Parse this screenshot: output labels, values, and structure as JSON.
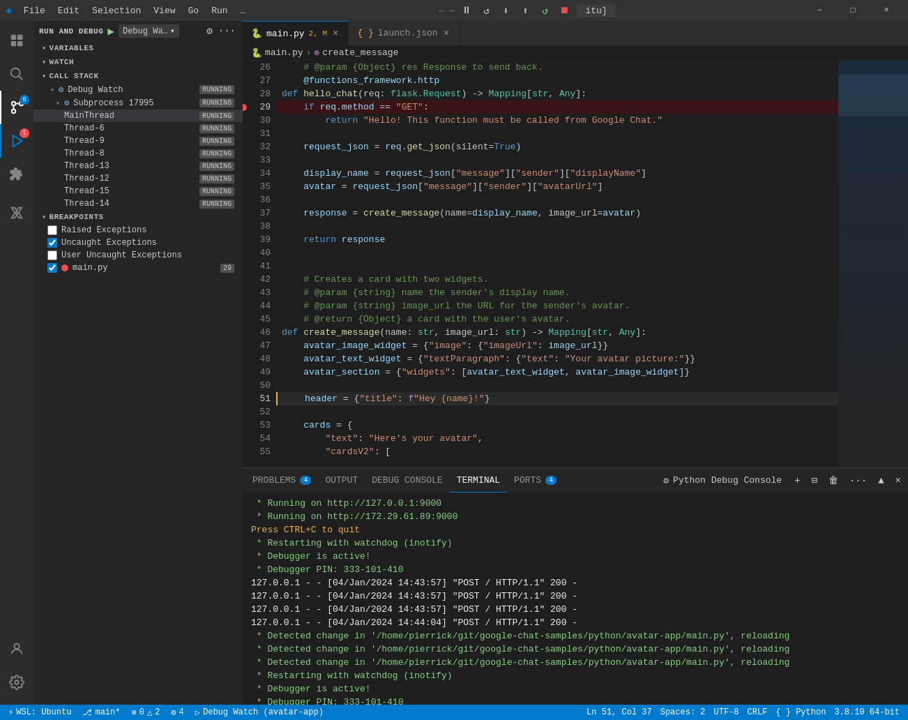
{
  "titlebar": {
    "logo": "◈",
    "menus": [
      "File",
      "Edit",
      "Selection",
      "View",
      "Go",
      "Run",
      "…"
    ],
    "debug_controls": [
      "⏪",
      "⏸",
      "↺",
      "⬇",
      "⬆",
      "⬅",
      "➡",
      "⏹"
    ],
    "nav_back": "←",
    "nav_forward": "→",
    "address": "itu]",
    "window_controls": [
      "−",
      "□",
      "×"
    ]
  },
  "activity": {
    "items": [
      "⎘",
      "🔍",
      "⎇",
      "▷",
      "☵",
      "⚗"
    ]
  },
  "sidebar": {
    "run_debug_title": "RUN AND DEBUG",
    "debug_config": "Debug Wa…",
    "sections": {
      "variables": "VARIABLES",
      "watch": "WATCH",
      "call_stack": "CALL STACK",
      "breakpoints": "BREAKPOINTS"
    },
    "call_stack_items": [
      {
        "name": "Debug Watch",
        "type": "thread",
        "badge": "RUNNING",
        "expanded": true
      },
      {
        "name": "Subprocess 17995",
        "type": "subprocess",
        "badge": "RUNNING",
        "expanded": true
      },
      {
        "name": "MainThread",
        "type": "thread",
        "badge": "RUNNING"
      },
      {
        "name": "Thread-6",
        "type": "thread",
        "badge": "RUNNING"
      },
      {
        "name": "Thread-9",
        "type": "thread",
        "badge": "RUNNING"
      },
      {
        "name": "Thread-8",
        "type": "thread",
        "badge": "RUNNING"
      },
      {
        "name": "Thread-13",
        "type": "thread",
        "badge": "RUNNING"
      },
      {
        "name": "Thread-12",
        "type": "thread",
        "badge": "RUNNING"
      },
      {
        "name": "Thread-15",
        "type": "thread",
        "badge": "RUNNING"
      },
      {
        "name": "Thread-14",
        "type": "thread",
        "badge": "RUNNING"
      }
    ],
    "breakpoints": [
      {
        "label": "Raised Exceptions",
        "checked": false,
        "has_dot": false
      },
      {
        "label": "Uncaught Exceptions",
        "checked": true,
        "has_dot": false
      },
      {
        "label": "User Uncaught Exceptions",
        "checked": false,
        "has_dot": false
      },
      {
        "label": "main.py",
        "checked": true,
        "has_dot": true,
        "count": "29"
      }
    ]
  },
  "tabs": [
    {
      "label": "main.py",
      "icon": "🐍",
      "modified": true,
      "count": "2, M",
      "active": true
    },
    {
      "label": "launch.json",
      "icon": "{}",
      "modified": false,
      "active": false
    }
  ],
  "breadcrumb": {
    "file": "main.py",
    "func": "create_message"
  },
  "code": {
    "lines": [
      {
        "num": 26,
        "content": "    # @param {Object} res Response to send back.",
        "class": "cm"
      },
      {
        "num": 27,
        "content": "    @functions_framework.http",
        "class": "at"
      },
      {
        "num": 28,
        "content": "def hello_chat(req: flask.Request) -> Mapping[str, Any]:",
        "class": "mixed"
      },
      {
        "num": 29,
        "content": "    if req.method == \"GET\":",
        "class": "mixed",
        "breakpoint": true
      },
      {
        "num": 30,
        "content": "        return \"Hello! This function must be called from Google Chat.\"",
        "class": "mixed"
      },
      {
        "num": 31,
        "content": "",
        "class": ""
      },
      {
        "num": 32,
        "content": "    request_json = req.get_json(silent=True)",
        "class": "mixed"
      },
      {
        "num": 33,
        "content": "",
        "class": ""
      },
      {
        "num": 34,
        "content": "    display_name = request_json[\"message\"][\"sender\"][\"displayName\"]",
        "class": "mixed"
      },
      {
        "num": 35,
        "content": "    avatar = request_json[\"message\"][\"sender\"][\"avatarUrl\"]",
        "class": "mixed"
      },
      {
        "num": 36,
        "content": "",
        "class": ""
      },
      {
        "num": 37,
        "content": "    response = create_message(name=display_name, image_url=avatar)",
        "class": "mixed"
      },
      {
        "num": 38,
        "content": "",
        "class": ""
      },
      {
        "num": 39,
        "content": "    return response",
        "class": "mixed"
      },
      {
        "num": 40,
        "content": "",
        "class": ""
      },
      {
        "num": 41,
        "content": "",
        "class": ""
      },
      {
        "num": 42,
        "content": "    # Creates a card with two widgets.",
        "class": "cm"
      },
      {
        "num": 43,
        "content": "    # @param {string} name the sender's display name.",
        "class": "cm"
      },
      {
        "num": 44,
        "content": "    # @param {string} image_url the URL for the sender's avatar.",
        "class": "cm"
      },
      {
        "num": 45,
        "content": "    # @return {Object} a card with the user's avatar.",
        "class": "cm"
      },
      {
        "num": 46,
        "content": "def create_message(name: str, image_url: str) -> Mapping[str, Any]:",
        "class": "mixed"
      },
      {
        "num": 47,
        "content": "    avatar_image_widget = {\"image\": {\"imageUrl\": image_url}}",
        "class": "mixed"
      },
      {
        "num": 48,
        "content": "    avatar_text_widget = {\"textParagraph\": {\"text\": \"Your avatar picture:\"}}",
        "class": "mixed"
      },
      {
        "num": 49,
        "content": "    avatar_section = {\"widgets\": [avatar_text_widget, avatar_image_widget]}",
        "class": "mixed"
      },
      {
        "num": 50,
        "content": "",
        "class": ""
      },
      {
        "num": 51,
        "content": "    header = {\"title\": f\"Hey {name}!\"}",
        "class": "mixed",
        "active": true
      },
      {
        "num": 52,
        "content": "",
        "class": ""
      },
      {
        "num": 53,
        "content": "    cards = {",
        "class": "mixed"
      },
      {
        "num": 54,
        "content": "        \"text\": \"Here's your avatar\",",
        "class": "mixed"
      },
      {
        "num": 55,
        "content": "        \"cardsV2\": [",
        "class": "mixed"
      }
    ]
  },
  "panel": {
    "tabs": [
      {
        "label": "PROBLEMS",
        "badge": "4"
      },
      {
        "label": "OUTPUT"
      },
      {
        "label": "DEBUG CONSOLE"
      },
      {
        "label": "TERMINAL",
        "active": true
      },
      {
        "label": "PORTS",
        "badge": "4"
      }
    ],
    "python_debug_console_label": "Python Debug Console",
    "terminal_lines": [
      {
        "text": " * Running on http://127.0.0.1:9000",
        "color": "green"
      },
      {
        "text": " * Running on http://172.29.61.89:9000",
        "color": "green"
      },
      {
        "text": "Press CTRL+C to quit",
        "color": "yellow"
      },
      {
        "text": " * Restarting with watchdog (inotify)",
        "color": "green"
      },
      {
        "text": " * Debugger is active!",
        "color": "green"
      },
      {
        "text": " * Debugger PIN: 333-101-410",
        "color": "green"
      },
      {
        "text": "127.0.0.1 - - [04/Jan/2024 14:43:57] \"POST / HTTP/1.1\" 200 -",
        "color": "white"
      },
      {
        "text": "127.0.0.1 - - [04/Jan/2024 14:43:57] \"POST / HTTP/1.1\" 200 -",
        "color": "white"
      },
      {
        "text": "127.0.0.1 - - [04/Jan/2024 14:43:57] \"POST / HTTP/1.1\" 200 -",
        "color": "white"
      },
      {
        "text": "127.0.0.1 - - [04/Jan/2024 14:44:04] \"POST / HTTP/1.1\" 200 -",
        "color": "white"
      },
      {
        "text": " * Detected change in '/home/pierrick/git/google-chat-samples/python/avatar-app/main.py', reloading",
        "color": "green"
      },
      {
        "text": " * Detected change in '/home/pierrick/git/google-chat-samples/python/avatar-app/main.py', reloading",
        "color": "green"
      },
      {
        "text": " * Detected change in '/home/pierrick/git/google-chat-samples/python/avatar-app/main.py', reloading",
        "color": "green"
      },
      {
        "text": " * Restarting with watchdog (inotify)",
        "color": "green"
      },
      {
        "text": " * Debugger is active!",
        "color": "green"
      },
      {
        "text": " * Debugger PIN: 333-101-410",
        "color": "green"
      }
    ]
  },
  "statusbar": {
    "left": [
      {
        "label": "⚡ WSL: Ubuntu"
      },
      {
        "label": "⎇ main*"
      },
      {
        "label": "⚠ 0 △ 2"
      },
      {
        "label": "⚙ 4"
      },
      {
        "label": "▷ Debug Watch (avatar-app)"
      }
    ],
    "right": [
      {
        "label": "Ln 51, Col 37"
      },
      {
        "label": "Spaces: 2"
      },
      {
        "label": "UTF-8"
      },
      {
        "label": "CRLF"
      },
      {
        "label": "{ } Python"
      },
      {
        "label": "3.8.10 64-bit"
      }
    ]
  }
}
